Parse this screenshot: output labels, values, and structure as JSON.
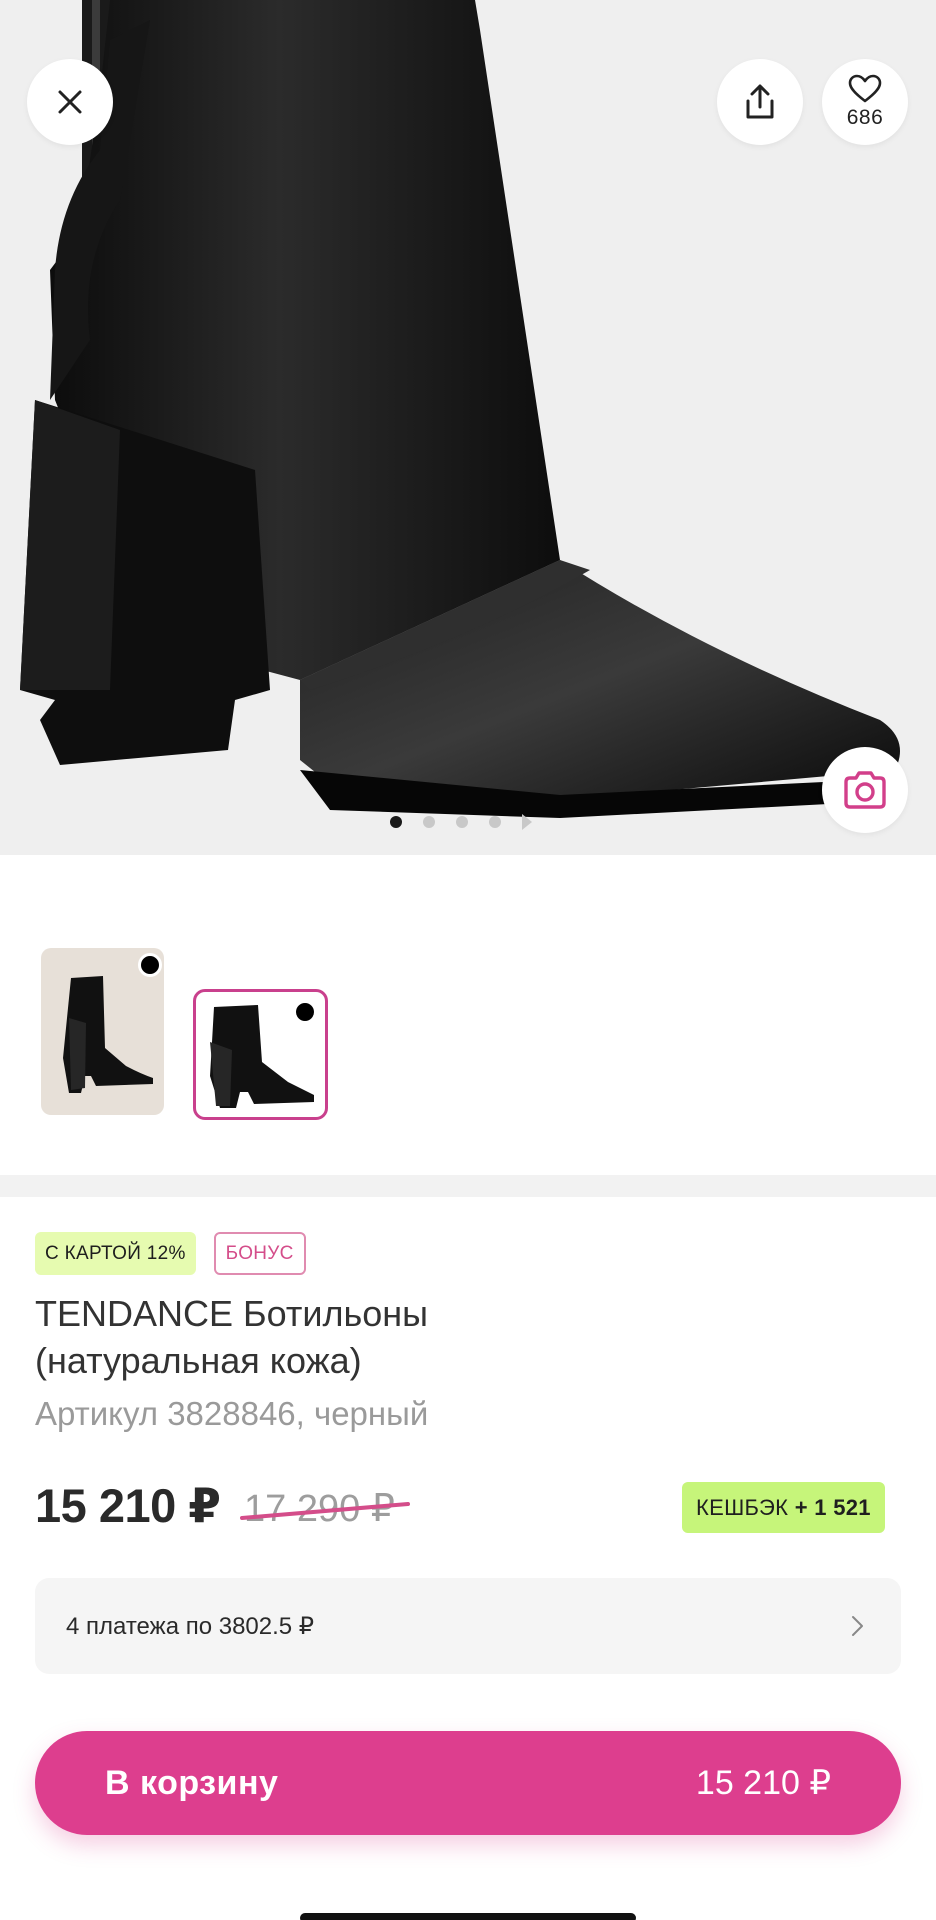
{
  "hero": {
    "favorites_count": "686",
    "gallery_pages": 5,
    "gallery_active_index": 0
  },
  "thumbnails": [
    {
      "color": "#000000",
      "selected": false
    },
    {
      "color": "#000000",
      "selected": true
    }
  ],
  "badges": {
    "card_discount": "С КАРТОЙ 12%",
    "bonus": "БОНУС"
  },
  "product": {
    "title_line1": "TENDANCE Ботильоны",
    "title_line2": "(натуральная кожа)",
    "article": "Артикул 3828846, черный"
  },
  "pricing": {
    "price": "15 210 ₽",
    "old_price": "17 290 ₽",
    "cashback_label": "КЕШБЭК",
    "cashback_value": "+ 1 521"
  },
  "installments": {
    "text": "4 платежа по 3802.5 ₽"
  },
  "cart": {
    "label": "В корзину",
    "price": "15 210 ₽"
  },
  "colors": {
    "accent": "#dd3e8e",
    "card_badge_bg": "#e6fbb0",
    "cashback_bg": "#c6f57a"
  }
}
